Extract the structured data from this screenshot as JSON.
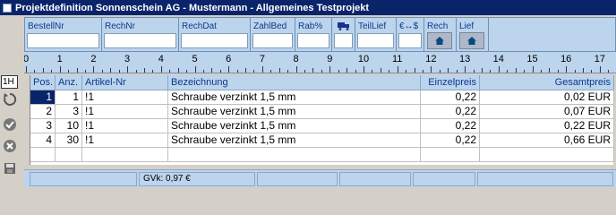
{
  "window": {
    "title": "Projektdefinition  Sonnenschein AG - Mustermann - Allgemeines Testprojekt"
  },
  "header_fields": {
    "bestell_nr": "BestellNr",
    "rech_nr": "RechNr",
    "rech_dat": "RechDat",
    "zahl_bed": "ZahlBed",
    "rab_pct": "Rab%",
    "teil_lief": "TeilLief",
    "currency": "€↔$",
    "rech": "Rech",
    "lief": "Lief"
  },
  "ruler": {
    "numbers": [
      "0",
      "1",
      "2",
      "3",
      "4",
      "5",
      "6",
      "7",
      "8",
      "9",
      "10",
      "11",
      "12",
      "13",
      "14",
      "15",
      "16",
      "17"
    ]
  },
  "line_indicator": "1H",
  "table": {
    "headers": {
      "pos": "Pos.",
      "anz": "Anz.",
      "artikel": "Artikel-Nr",
      "bezeichnung": "Bezeichnung",
      "einzelpreis": "Einzelpreis",
      "gesamtpreis": "Gesamtpreis"
    },
    "rows": [
      {
        "pos": "1",
        "anz": "1",
        "artikel": "!1",
        "bezeichnung": "Schraube verzinkt 1,5 mm",
        "einzelpreis": "0,22",
        "gesamtpreis": "0,02 EUR"
      },
      {
        "pos": "2",
        "anz": "3",
        "artikel": "!1",
        "bezeichnung": "Schraube verzinkt 1,5 mm",
        "einzelpreis": "0,22",
        "gesamtpreis": "0,07 EUR"
      },
      {
        "pos": "3",
        "anz": "10",
        "artikel": "!1",
        "bezeichnung": "Schraube verzinkt 1,5 mm",
        "einzelpreis": "0,22",
        "gesamtpreis": "0,22 EUR"
      },
      {
        "pos": "4",
        "anz": "30",
        "artikel": "!1",
        "bezeichnung": "Schraube verzinkt 1,5 mm",
        "einzelpreis": "0,22",
        "gesamtpreis": "0,66 EUR"
      }
    ]
  },
  "status": {
    "gvk": "GVk: 0,97 €"
  },
  "icons": [
    "app-icon",
    "truck-icon",
    "home-icon",
    "refresh-icon",
    "check-icon",
    "cancel-icon",
    "save-icon"
  ],
  "colors": {
    "titlebar": "#0a246a",
    "panel": "#bcd4ec",
    "label_text": "#0b3a8e",
    "selection": "#0a246a"
  }
}
